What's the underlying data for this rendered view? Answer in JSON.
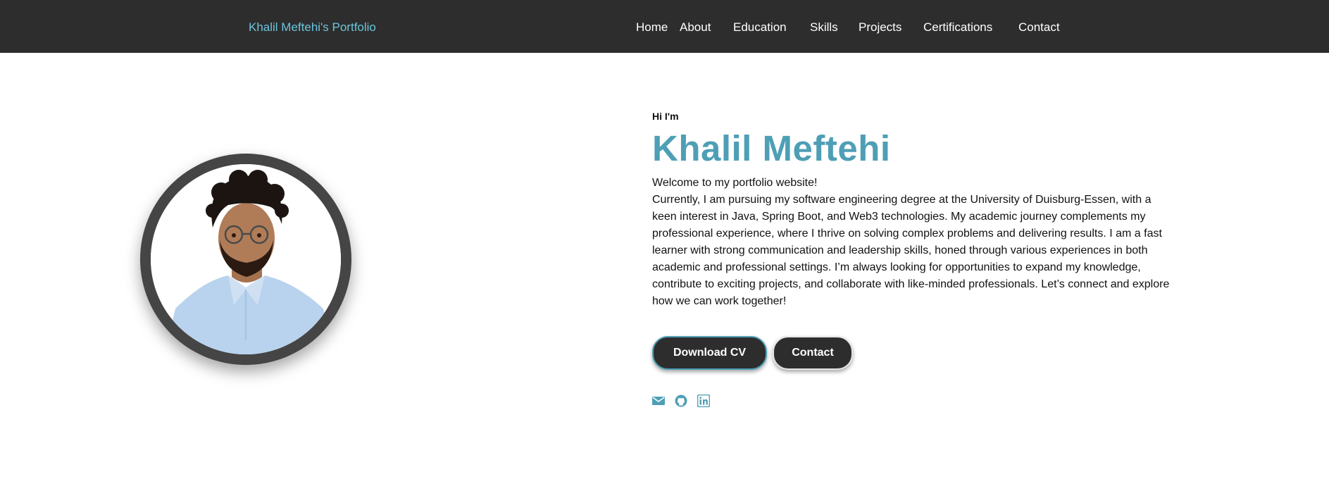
{
  "navbar": {
    "brand": "Khalil Meftehi's Portfolio",
    "links": [
      "Home",
      "About",
      "Education",
      "Skills",
      "Projects",
      "Certifications",
      "Contact"
    ]
  },
  "hero": {
    "photo_icon": "profile-photo",
    "greeting": "Hi I'm",
    "name": "Khalil Meftehi",
    "welcome": "Welcome to my portfolio website!",
    "bio": "Currently, I am pursuing my software engineering degree at the University of Duisburg-Essen, with a keen interest in Java, Spring Boot, and Web3 technologies. My academic journey complements my professional experience, where I thrive on solving complex problems and delivering results. I am a fast learner with strong communication and leadership skills, honed through various experiences in both academic and professional settings. I’m always looking for opportunities to expand my knowledge, contribute to exciting projects, and collaborate with like-minded professionals. Let’s connect and explore how we can work together!",
    "buttons": {
      "download_cv": "Download CV",
      "contact": "Contact"
    },
    "socials": [
      "envelope-icon",
      "github-icon",
      "linkedin-icon"
    ]
  },
  "colors": {
    "navbar_bg": "#2d2d2d",
    "brand": "#6cc4dc",
    "accent": "#4e9fb6",
    "button_bg": "#2d2d2d"
  }
}
